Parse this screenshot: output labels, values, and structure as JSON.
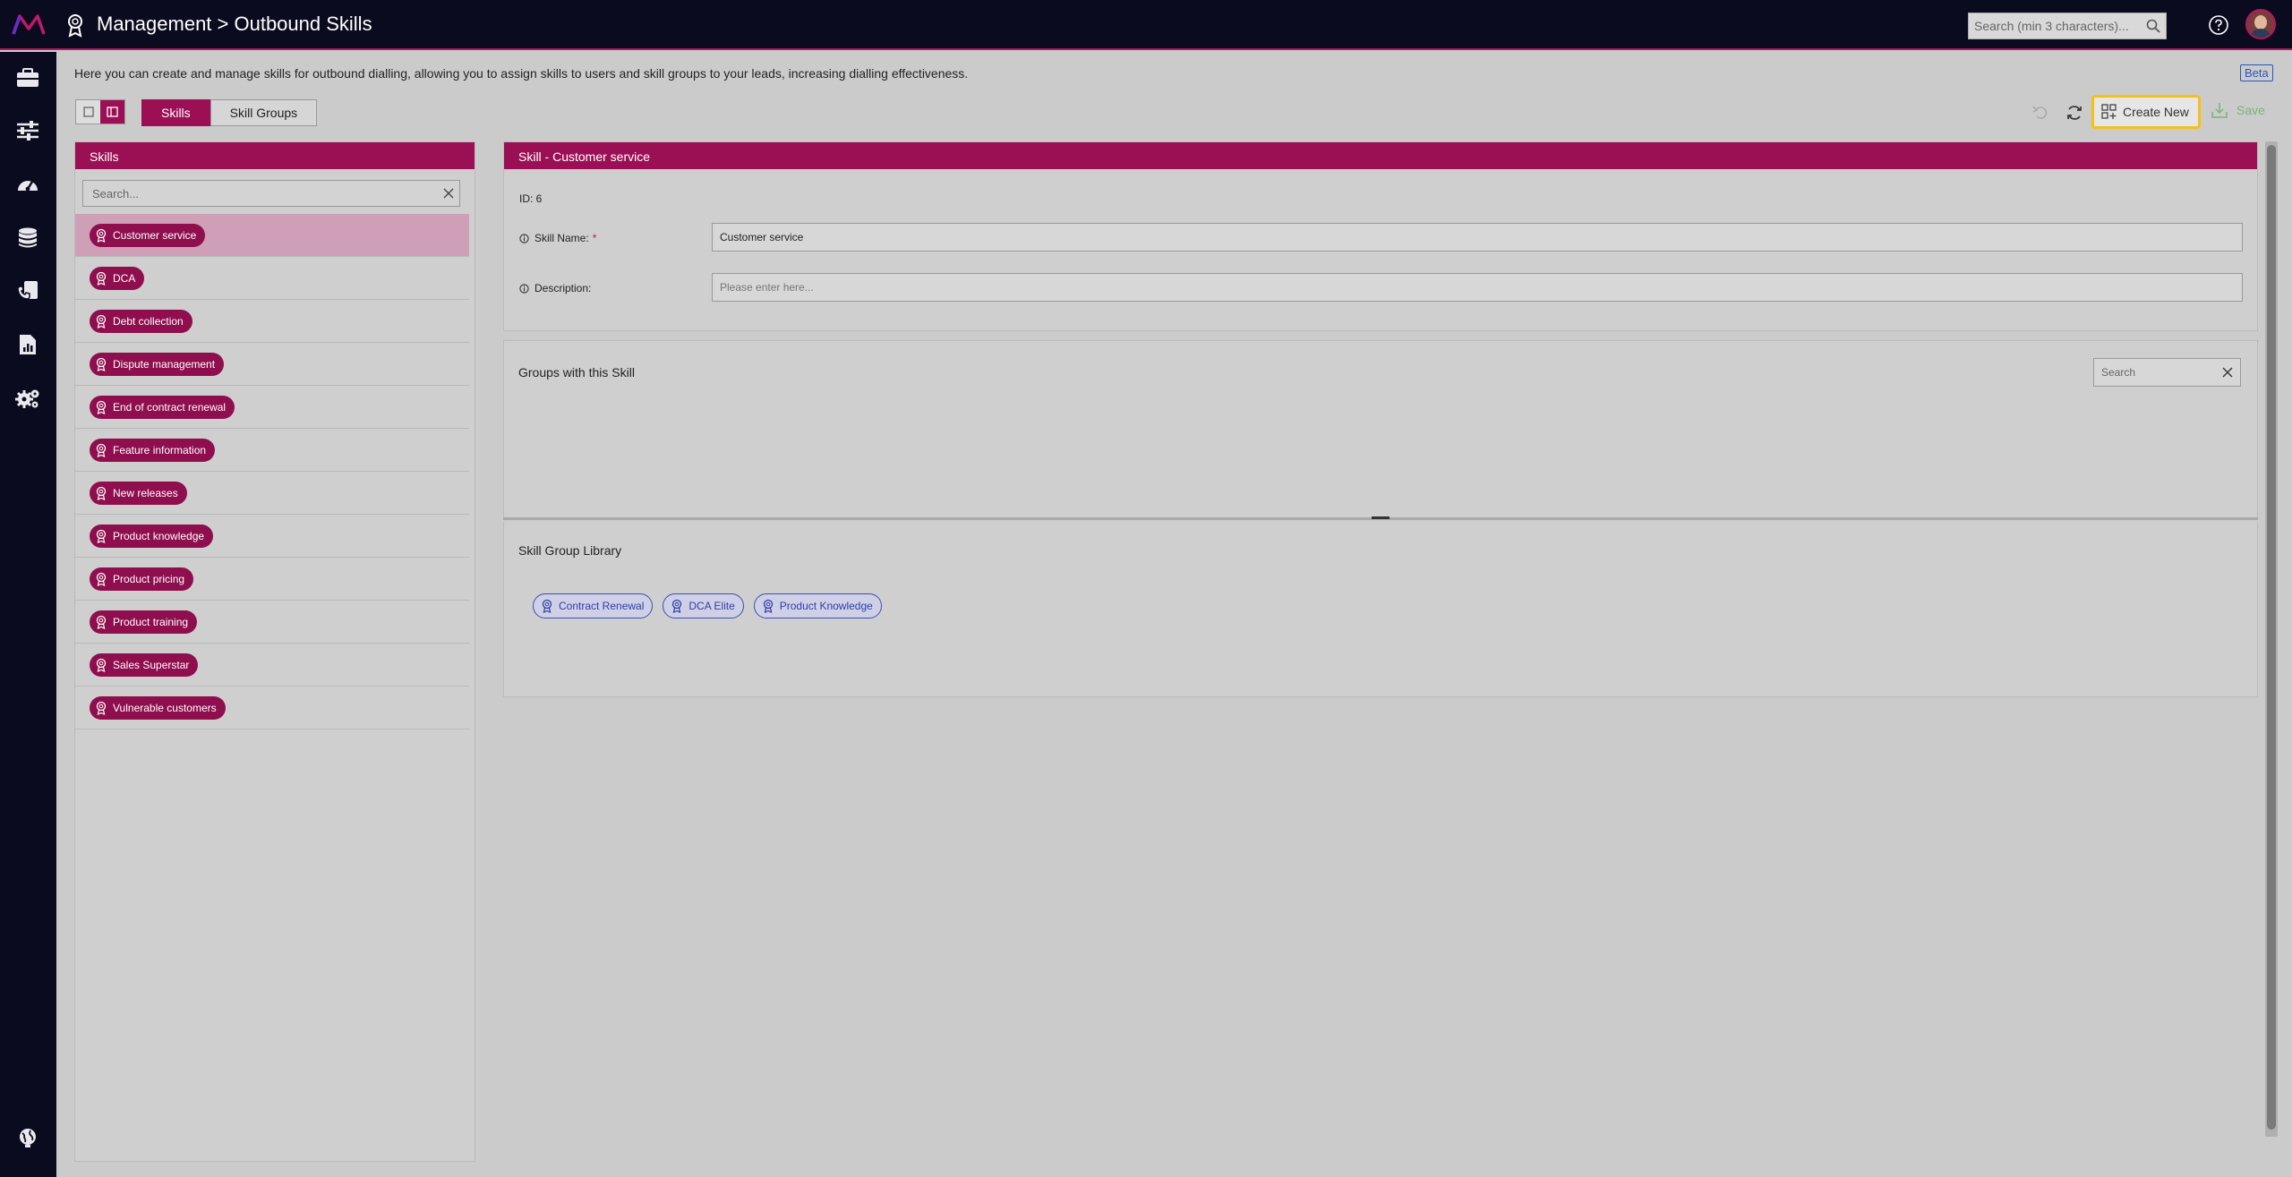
{
  "header": {
    "breadcrumb": "Management > Outbound Skills",
    "search_placeholder": "Search (min 3 characters)..."
  },
  "nav": {
    "items": [
      "briefcase-icon",
      "sliders-icon",
      "dashboard-icon",
      "database-icon",
      "phone-document-icon",
      "report-icon",
      "settings-gears-icon"
    ],
    "bottom": "globe-icon"
  },
  "page": {
    "description": "Here you can create and manage skills for outbound dialling, allowing you to assign skills to users and skill groups to your leads, increasing dialling effectiveness.",
    "beta_label": "Beta"
  },
  "toolbar": {
    "tabs": [
      {
        "label": "Skills",
        "active": true
      },
      {
        "label": "Skill Groups",
        "active": false
      }
    ],
    "create_label": "Create New",
    "save_label": "Save"
  },
  "skills_panel": {
    "title": "Skills",
    "search_placeholder": "Search...",
    "items": [
      {
        "label": "Customer service",
        "selected": true
      },
      {
        "label": "DCA",
        "selected": false
      },
      {
        "label": "Debt collection",
        "selected": false
      },
      {
        "label": "Dispute management",
        "selected": false
      },
      {
        "label": "End of contract renewal",
        "selected": false
      },
      {
        "label": "Feature information",
        "selected": false
      },
      {
        "label": "New releases",
        "selected": false
      },
      {
        "label": "Product knowledge",
        "selected": false
      },
      {
        "label": "Product pricing",
        "selected": false
      },
      {
        "label": "Product training",
        "selected": false
      },
      {
        "label": "Sales Superstar",
        "selected": false
      },
      {
        "label": "Vulnerable customers",
        "selected": false
      }
    ]
  },
  "detail": {
    "title": "Skill - Customer service",
    "id_label": "ID: 6",
    "skill_name_label": "Skill Name:",
    "required_mark": "*",
    "skill_name_value": "Customer service",
    "description_label": "Description:",
    "description_placeholder": "Please enter here..."
  },
  "groups": {
    "title": "Groups with this Skill",
    "search_placeholder": "Search"
  },
  "library": {
    "title": "Skill Group Library",
    "items": [
      "Contract Renewal",
      "DCA Elite",
      "Product Knowledge"
    ]
  },
  "colors": {
    "brand": "#9b0f55",
    "topbar": "#0b0b1f",
    "highlight": "#f5c019",
    "library_pill": "#2c3ea8"
  }
}
